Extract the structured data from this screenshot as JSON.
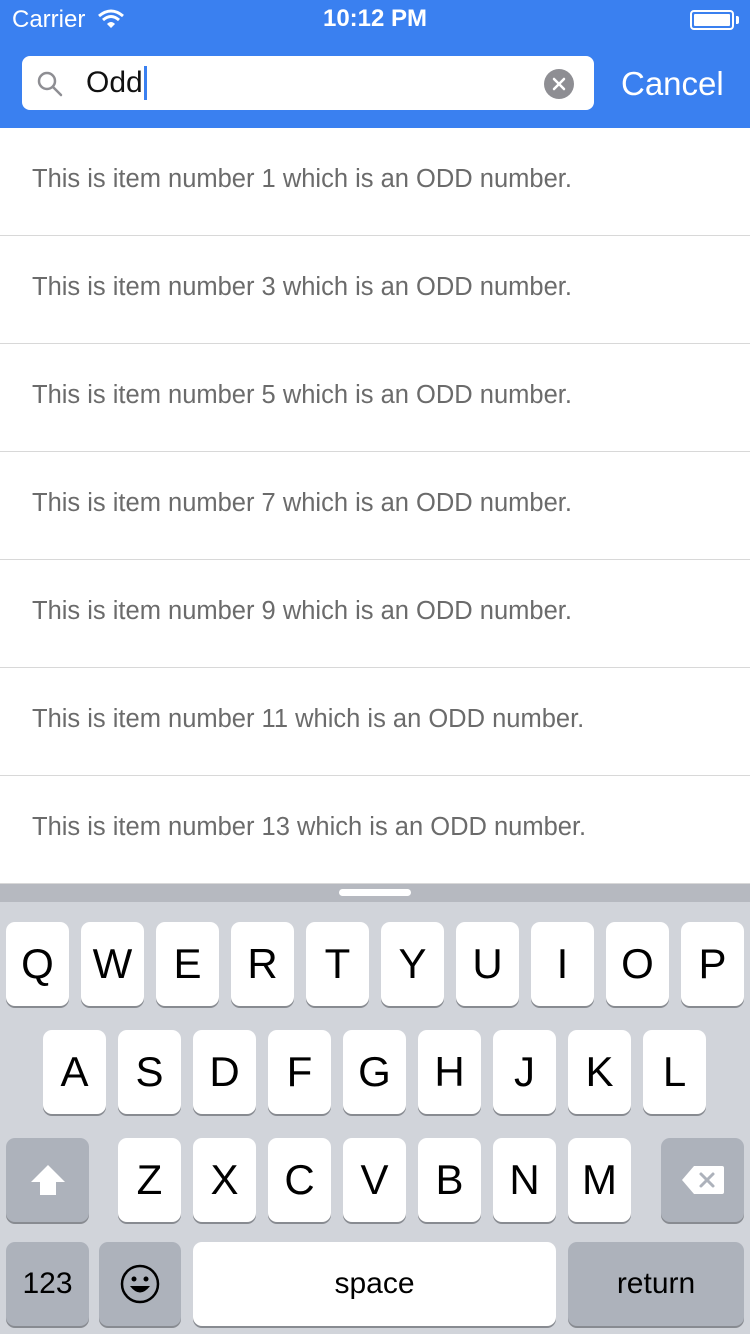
{
  "status_bar": {
    "carrier": "Carrier",
    "time": "10:12 PM"
  },
  "search": {
    "query": "Odd",
    "cancel_label": "Cancel"
  },
  "results": [
    "This is item number 1 which is an ODD number.",
    "This is item number 3 which is an ODD number.",
    "This is item number 5 which is an ODD number.",
    "This is item number 7 which is an ODD number.",
    "This is item number 9 which is an ODD number.",
    "This is item number 11 which is an ODD number.",
    "This is item number 13 which is an ODD number."
  ],
  "keyboard": {
    "row1": [
      "Q",
      "W",
      "E",
      "R",
      "T",
      "Y",
      "U",
      "I",
      "O",
      "P"
    ],
    "row2": [
      "A",
      "S",
      "D",
      "F",
      "G",
      "H",
      "J",
      "K",
      "L"
    ],
    "row3": [
      "Z",
      "X",
      "C",
      "V",
      "B",
      "N",
      "M"
    ],
    "numbers_label": "123",
    "space_label": "space",
    "return_label": "return",
    "icons": {
      "shift": "shift-icon",
      "backspace": "backspace-icon",
      "emoji": "emoji-icon"
    }
  },
  "colors": {
    "accent": "#3a80f0",
    "row_text": "#6b6b6b",
    "keyboard_bg": "#d1d4da"
  }
}
